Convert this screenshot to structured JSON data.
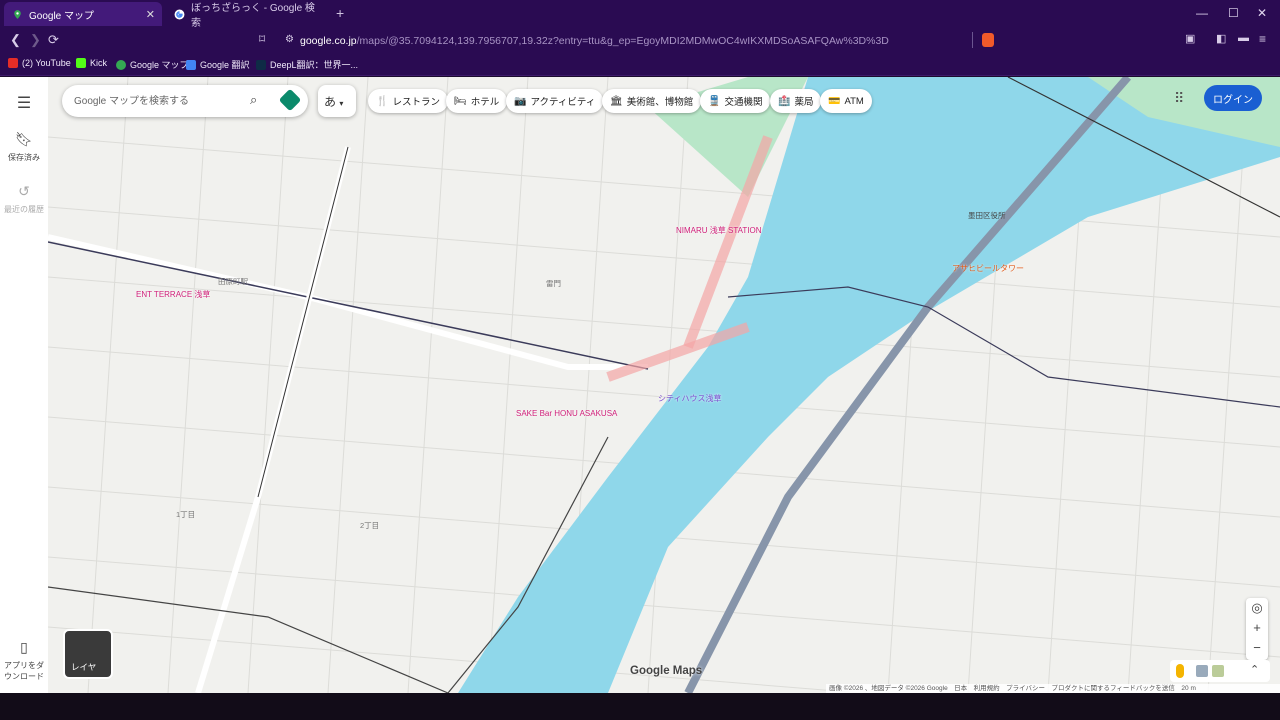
{
  "browser": {
    "tabs": [
      {
        "title": "Google マップ",
        "active": true
      },
      {
        "title": "ぼっちざらっく - Google 検索",
        "active": false
      }
    ],
    "new_tab": "+",
    "window": {
      "minimize": "—",
      "maximize": "☐",
      "close": "✕"
    },
    "url_host": "google.co.jp",
    "url_path": "/maps/@35.7094124,139.7956707,19.32z?entry=ttu&g_ep=EgoyMDI2MDMwOC4wIKXMDSoASAFQAw%3D%3D",
    "bookmarks": [
      {
        "label": "(2) YouTube",
        "color": "#e52d27"
      },
      {
        "label": "Kick",
        "color": "#53fc18"
      },
      {
        "label": "Google マップ",
        "color": "#34a853"
      },
      {
        "label": "Google 翻訳",
        "color": "#4285f4"
      },
      {
        "label": "DeepL翻訳：世界一...",
        "color": "#0f2b46"
      }
    ]
  },
  "maps": {
    "search_placeholder": "Google マップを検索する",
    "lang_label": "あ",
    "chips": [
      {
        "label": "レストラン",
        "icon": "🍴"
      },
      {
        "label": "ホテル",
        "icon": "🛏"
      },
      {
        "label": "アクティビティ",
        "icon": "📷"
      },
      {
        "label": "美術館、博物館",
        "icon": "🏛"
      },
      {
        "label": "交通機関",
        "icon": "🚆"
      },
      {
        "label": "薬局",
        "icon": "🏥"
      },
      {
        "label": "ATM",
        "icon": "💳"
      }
    ],
    "login": "ログイン",
    "rail": {
      "menu": "☰",
      "saved": "保存済み",
      "recent": "最近の履歴",
      "app": "アプリをダウンロード"
    },
    "layers_label": "レイヤ",
    "logo": "Google Maps",
    "attribution": "画像 ©2026 、地図データ ©2026 Google　日本　利用規約　プライバシー　プロダクトに関するフィードバックを送信　20 m",
    "labels": {
      "poi": [
        {
          "text": "NIMARU 浅草 STATION"
        },
        {
          "text": "ENT TERRACE 浅草"
        },
        {
          "text": "SAKE Bar HONU ASAKUSA"
        },
        {
          "text": "アサヒビールタワー"
        },
        {
          "text": "シティハウス浅草"
        }
      ],
      "areas": [
        {
          "text": "墨田区役所"
        },
        {
          "text": "雷門"
        },
        {
          "text": "1丁目"
        },
        {
          "text": "2丁目"
        },
        {
          "text": "田原町駅"
        }
      ]
    }
  }
}
